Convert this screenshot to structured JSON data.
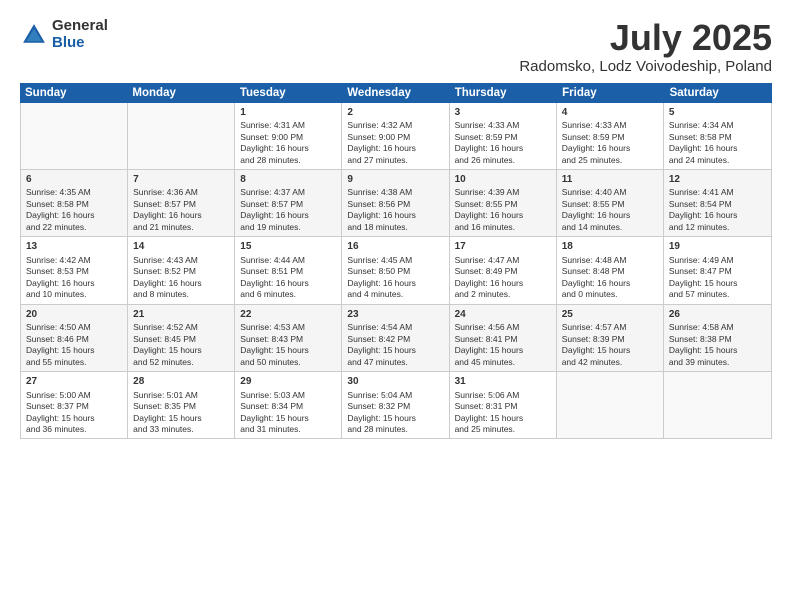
{
  "logo": {
    "general": "General",
    "blue": "Blue"
  },
  "title": {
    "month_year": "July 2025",
    "location": "Radomsko, Lodz Voivodeship, Poland"
  },
  "headers": [
    "Sunday",
    "Monday",
    "Tuesday",
    "Wednesday",
    "Thursday",
    "Friday",
    "Saturday"
  ],
  "weeks": [
    [
      {
        "day": "",
        "info": ""
      },
      {
        "day": "",
        "info": ""
      },
      {
        "day": "1",
        "info": "Sunrise: 4:31 AM\nSunset: 9:00 PM\nDaylight: 16 hours\nand 28 minutes."
      },
      {
        "day": "2",
        "info": "Sunrise: 4:32 AM\nSunset: 9:00 PM\nDaylight: 16 hours\nand 27 minutes."
      },
      {
        "day": "3",
        "info": "Sunrise: 4:33 AM\nSunset: 8:59 PM\nDaylight: 16 hours\nand 26 minutes."
      },
      {
        "day": "4",
        "info": "Sunrise: 4:33 AM\nSunset: 8:59 PM\nDaylight: 16 hours\nand 25 minutes."
      },
      {
        "day": "5",
        "info": "Sunrise: 4:34 AM\nSunset: 8:58 PM\nDaylight: 16 hours\nand 24 minutes."
      }
    ],
    [
      {
        "day": "6",
        "info": "Sunrise: 4:35 AM\nSunset: 8:58 PM\nDaylight: 16 hours\nand 22 minutes."
      },
      {
        "day": "7",
        "info": "Sunrise: 4:36 AM\nSunset: 8:57 PM\nDaylight: 16 hours\nand 21 minutes."
      },
      {
        "day": "8",
        "info": "Sunrise: 4:37 AM\nSunset: 8:57 PM\nDaylight: 16 hours\nand 19 minutes."
      },
      {
        "day": "9",
        "info": "Sunrise: 4:38 AM\nSunset: 8:56 PM\nDaylight: 16 hours\nand 18 minutes."
      },
      {
        "day": "10",
        "info": "Sunrise: 4:39 AM\nSunset: 8:55 PM\nDaylight: 16 hours\nand 16 minutes."
      },
      {
        "day": "11",
        "info": "Sunrise: 4:40 AM\nSunset: 8:55 PM\nDaylight: 16 hours\nand 14 minutes."
      },
      {
        "day": "12",
        "info": "Sunrise: 4:41 AM\nSunset: 8:54 PM\nDaylight: 16 hours\nand 12 minutes."
      }
    ],
    [
      {
        "day": "13",
        "info": "Sunrise: 4:42 AM\nSunset: 8:53 PM\nDaylight: 16 hours\nand 10 minutes."
      },
      {
        "day": "14",
        "info": "Sunrise: 4:43 AM\nSunset: 8:52 PM\nDaylight: 16 hours\nand 8 minutes."
      },
      {
        "day": "15",
        "info": "Sunrise: 4:44 AM\nSunset: 8:51 PM\nDaylight: 16 hours\nand 6 minutes."
      },
      {
        "day": "16",
        "info": "Sunrise: 4:45 AM\nSunset: 8:50 PM\nDaylight: 16 hours\nand 4 minutes."
      },
      {
        "day": "17",
        "info": "Sunrise: 4:47 AM\nSunset: 8:49 PM\nDaylight: 16 hours\nand 2 minutes."
      },
      {
        "day": "18",
        "info": "Sunrise: 4:48 AM\nSunset: 8:48 PM\nDaylight: 16 hours\nand 0 minutes."
      },
      {
        "day": "19",
        "info": "Sunrise: 4:49 AM\nSunset: 8:47 PM\nDaylight: 15 hours\nand 57 minutes."
      }
    ],
    [
      {
        "day": "20",
        "info": "Sunrise: 4:50 AM\nSunset: 8:46 PM\nDaylight: 15 hours\nand 55 minutes."
      },
      {
        "day": "21",
        "info": "Sunrise: 4:52 AM\nSunset: 8:45 PM\nDaylight: 15 hours\nand 52 minutes."
      },
      {
        "day": "22",
        "info": "Sunrise: 4:53 AM\nSunset: 8:43 PM\nDaylight: 15 hours\nand 50 minutes."
      },
      {
        "day": "23",
        "info": "Sunrise: 4:54 AM\nSunset: 8:42 PM\nDaylight: 15 hours\nand 47 minutes."
      },
      {
        "day": "24",
        "info": "Sunrise: 4:56 AM\nSunset: 8:41 PM\nDaylight: 15 hours\nand 45 minutes."
      },
      {
        "day": "25",
        "info": "Sunrise: 4:57 AM\nSunset: 8:39 PM\nDaylight: 15 hours\nand 42 minutes."
      },
      {
        "day": "26",
        "info": "Sunrise: 4:58 AM\nSunset: 8:38 PM\nDaylight: 15 hours\nand 39 minutes."
      }
    ],
    [
      {
        "day": "27",
        "info": "Sunrise: 5:00 AM\nSunset: 8:37 PM\nDaylight: 15 hours\nand 36 minutes."
      },
      {
        "day": "28",
        "info": "Sunrise: 5:01 AM\nSunset: 8:35 PM\nDaylight: 15 hours\nand 33 minutes."
      },
      {
        "day": "29",
        "info": "Sunrise: 5:03 AM\nSunset: 8:34 PM\nDaylight: 15 hours\nand 31 minutes."
      },
      {
        "day": "30",
        "info": "Sunrise: 5:04 AM\nSunset: 8:32 PM\nDaylight: 15 hours\nand 28 minutes."
      },
      {
        "day": "31",
        "info": "Sunrise: 5:06 AM\nSunset: 8:31 PM\nDaylight: 15 hours\nand 25 minutes."
      },
      {
        "day": "",
        "info": ""
      },
      {
        "day": "",
        "info": ""
      }
    ]
  ]
}
